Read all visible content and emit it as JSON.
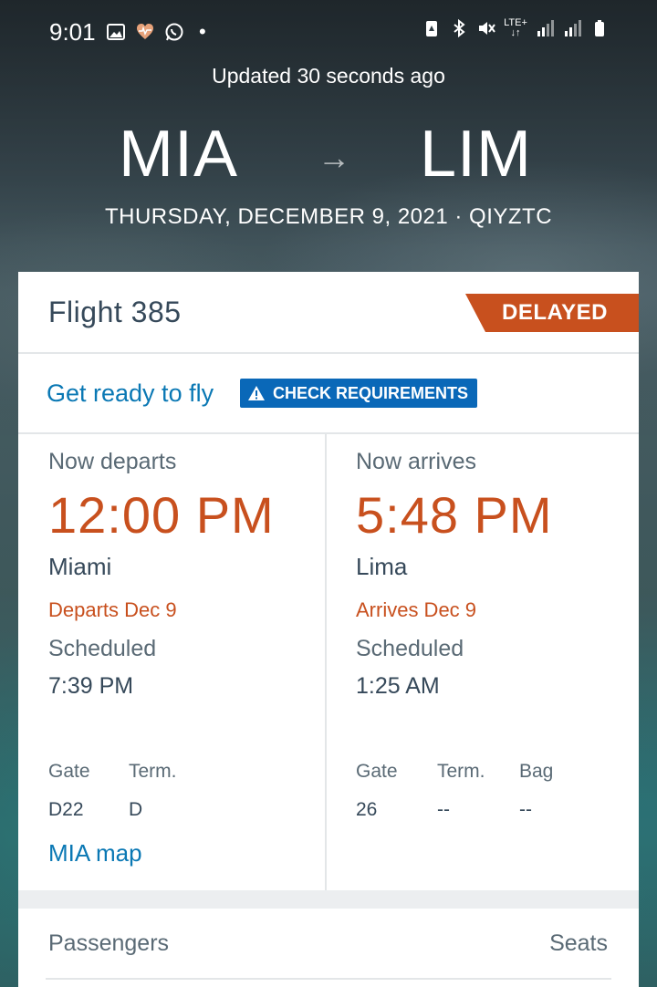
{
  "status_bar": {
    "time": "9:01",
    "dot": "•",
    "network": "LTE+",
    "left_icons": [
      "image-icon",
      "heart-rate-icon",
      "whatsapp-icon"
    ],
    "right_icons": [
      "battery-saver-icon",
      "bluetooth-icon",
      "mute-icon",
      "lte-icon",
      "signal-icon",
      "signal-icon",
      "battery-icon"
    ]
  },
  "header": {
    "updated": "Updated 30 seconds ago",
    "origin": "MIA",
    "destination": "LIM",
    "arrow": "→",
    "date_line": "THURSDAY, DECEMBER 9, 2021 · QIYZTC"
  },
  "flight": {
    "number": "Flight 385",
    "status": "DELAYED"
  },
  "ready": {
    "label": "Get ready to fly",
    "button": "CHECK REQUIREMENTS"
  },
  "departure": {
    "label": "Now departs",
    "time": "12:00 PM",
    "city": "Miami",
    "date": "Departs Dec 9",
    "scheduled_label": "Scheduled",
    "scheduled_time": "7:39 PM",
    "gate_label": "Gate",
    "gate": "D22",
    "term_label": "Term.",
    "term": "D",
    "map_link": "MIA map"
  },
  "arrival": {
    "label": "Now arrives",
    "time": "5:48 PM",
    "city": "Lima",
    "date": "Arrives Dec 9",
    "scheduled_label": "Scheduled",
    "scheduled_time": "1:25 AM",
    "gate_label": "Gate",
    "gate": "26",
    "term_label": "Term.",
    "term": "--",
    "bag_label": "Bag",
    "bag": "--"
  },
  "passengers": {
    "label": "Passengers",
    "seats_label": "Seats"
  },
  "colors": {
    "accent_orange": "#c8501e",
    "link_blue": "#0a78b4",
    "button_blue": "#0a68b8",
    "text_dark": "#36495a"
  }
}
